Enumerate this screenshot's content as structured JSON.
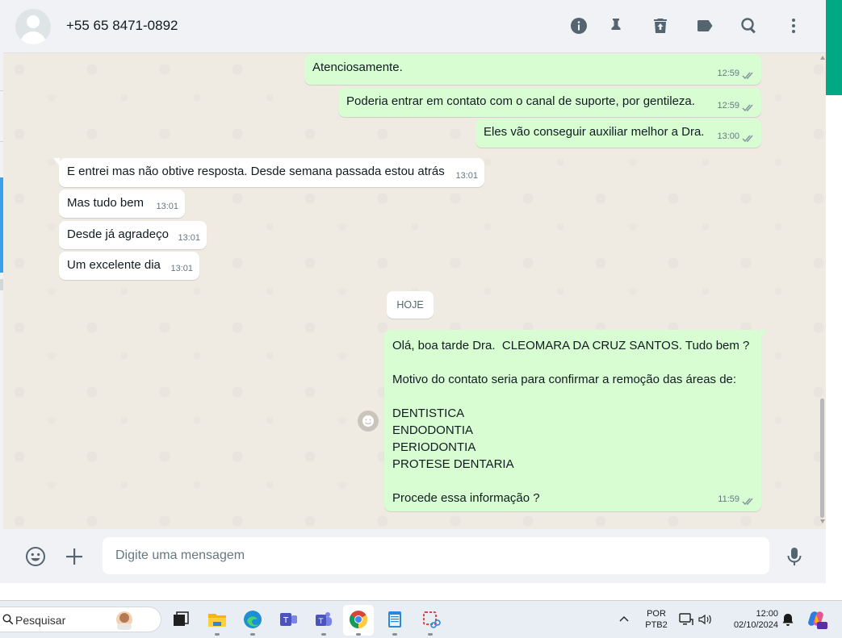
{
  "header": {
    "contact_name": "+55 65 8471-0892",
    "icons": [
      "info-icon",
      "pin-icon",
      "delete-icon",
      "label-icon",
      "search-icon",
      "menu-icon"
    ]
  },
  "messages": [
    {
      "id": "m1",
      "direction": "out",
      "text": "Atenciosamente.",
      "time": "12:59",
      "status": "read"
    },
    {
      "id": "m2",
      "direction": "out",
      "text": "Poderia entrar em contato com o canal de suporte, por gentileza.",
      "time": "12:59",
      "status": "read"
    },
    {
      "id": "m3",
      "direction": "out",
      "text": "Eles vão conseguir auxiliar melhor a Dra.",
      "time": "13:00",
      "status": "read"
    },
    {
      "id": "m4",
      "direction": "in",
      "text": "E entrei mas não obtive resposta. Desde semana passada estou atrás",
      "time": "13:01"
    },
    {
      "id": "m5",
      "direction": "in",
      "text": "Mas tudo bem",
      "time": "13:01"
    },
    {
      "id": "m6",
      "direction": "in",
      "text": "Desde já agradeço",
      "time": "13:01"
    },
    {
      "id": "m7",
      "direction": "in",
      "text": "Um excelente dia",
      "time": "13:01"
    },
    {
      "id": "m8",
      "direction": "out",
      "text": "Olá, boa tarde Dra.  CLEOMARA DA CRUZ SANTOS. Tudo bem ?\n\nMotivo do contato seria para confirmar a remoção das áreas de:\n\nDENTISTICA\nENDODONTIA\nPERIODONTIA\nPROTESE DENTARIA\n\nProcede essa informação ?",
      "time": "11:59",
      "status": "read"
    }
  ],
  "day_divider": "HOJE",
  "composer": {
    "placeholder": "Digite uma mensagem",
    "icons": [
      "emoji-icon",
      "attach-plus-icon",
      "microphone-icon"
    ]
  },
  "taskbar": {
    "search_label": "Pesquisar",
    "language": {
      "line1": "POR",
      "line2": "PTB2"
    },
    "clock": {
      "time": "12:00",
      "date": "02/10/2024"
    },
    "pinned_apps": [
      "task-view",
      "file-explorer",
      "edge",
      "teams-work",
      "teams",
      "chrome",
      "notepad",
      "snipping-tool"
    ]
  },
  "colors": {
    "outgoing_bubble": "#d9fdd3",
    "incoming_bubble": "#ffffff",
    "chat_background": "#efeae2",
    "header_background": "#f0f2f5",
    "read_ticks": "#53bdeb",
    "accent": "#00a884"
  }
}
